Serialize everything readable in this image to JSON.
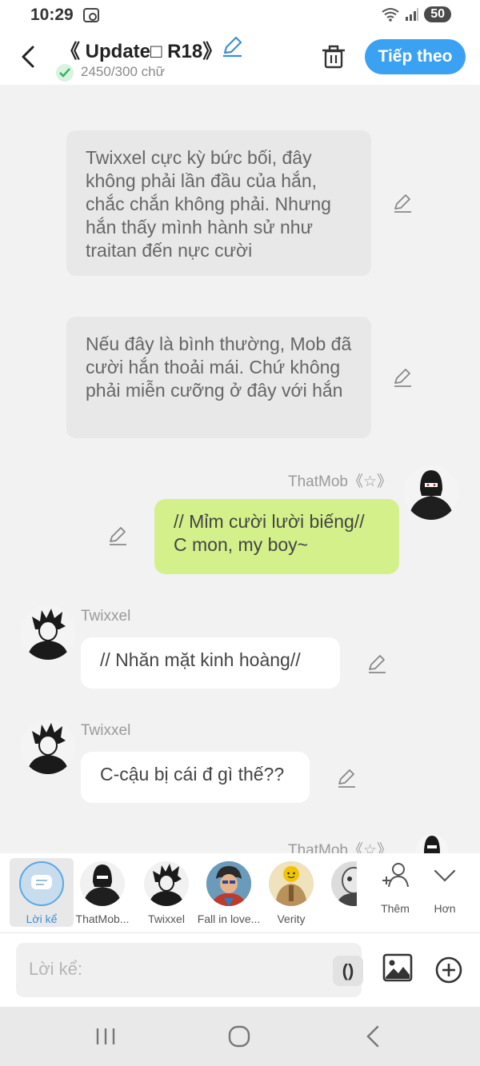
{
  "status": {
    "time": "10:29",
    "battery": "50"
  },
  "header": {
    "title": "《 Update□ R18》",
    "word_count": "2450/300 chữ",
    "next_label": "Tiếp theo"
  },
  "messages": [
    {
      "type": "narration",
      "text": "Twixxel cực kỳ bức bối, đây không phải lần đầu của hắn, chắc chắn không phải. Nhưng hắn thấy mình hành sử như traitan đến nực cười"
    },
    {
      "type": "narration",
      "text": "Nếu đây là bình thường, Mob đã cười hắn thoải mái. Chứ không phải miễn cưỡng ở đây với hắn"
    },
    {
      "type": "dialogue",
      "speaker": "ThatMob《☆》",
      "text": "// Mỉm cười lười biếng// C mon, my boy~"
    },
    {
      "type": "dialogue",
      "speaker": "Twixxel",
      "text": "// Nhăn mặt kinh hoàng//"
    },
    {
      "type": "dialogue",
      "speaker": "Twixxel",
      "text": "C-cậu bị cái đ gì thế??"
    },
    {
      "type": "dialogue",
      "speaker": "ThatMob《☆》",
      "text": ""
    }
  ],
  "characters": [
    {
      "label": "Lời kể"
    },
    {
      "label": "ThatMob..."
    },
    {
      "label": "Twixxel"
    },
    {
      "label": "Fall in love..."
    },
    {
      "label": "Verity"
    },
    {
      "label": ""
    }
  ],
  "actions": {
    "more_label": "Thêm",
    "collapse_label": "Hơn"
  },
  "input": {
    "placeholder": "Lời kể:",
    "paren_label": "()"
  },
  "colors": {
    "accent": "#3ba1f2",
    "green_bubble": "#d4f08a",
    "narration_bg": "#e8e8e8"
  }
}
